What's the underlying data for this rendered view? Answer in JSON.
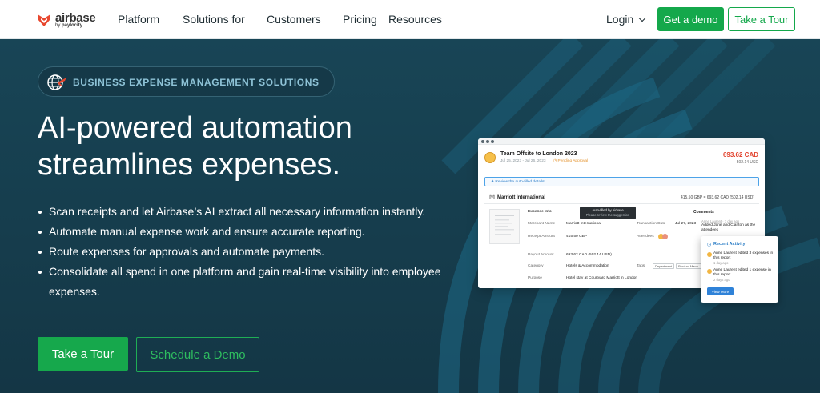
{
  "nav": {
    "logo_name": "airbase",
    "logo_sub_prefix": "by",
    "logo_sub_brand": "paylocity",
    "links": [
      "Platform",
      "Solutions for",
      "Customers",
      "Pricing",
      "Resources"
    ],
    "login": "Login",
    "get_demo": "Get a demo",
    "take_tour": "Take a Tour"
  },
  "hero": {
    "badge": "BUSINESS EXPENSE MANAGEMENT SOLUTIONS",
    "headline_line1": "AI-powered automation",
    "headline_line2": "streamlines expenses.",
    "bullets": [
      "Scan receipts and let Airbase’s AI extract all necessary information instantly.",
      "Automate manual expense work and ensure accurate reporting.",
      "Route expenses for approvals and automate payments.",
      "Consolidate all spend in one platform and gain real-time visibility into employee expenses."
    ],
    "cta_tour": "Take a Tour",
    "cta_demo": "Schedule a Demo"
  },
  "app": {
    "trip_title": "Team Offsite to London 2023",
    "trip_dates": "Jul 25, 2023 - Jul 26, 2023",
    "trip_status": "Pending Approval",
    "trip_amount": "693.62 CAD",
    "trip_amount_usd": "502.14 USD",
    "review_text": "Review the auto-filled details!",
    "merchant_title": "Marriott International",
    "merchant_amount": "415.50 GBP = 693.62 CAD (502.14 USD)",
    "section": "Expense Info",
    "fields": {
      "merchant_label": "Merchant Name",
      "merchant_value": "Marriott International",
      "receipt_label": "Receipt Amount",
      "receipt_value": "415.50 GBP",
      "payout_label": "Payout Amount",
      "payout_value": "693.62 CAD (502.14 USD)",
      "category_label": "Category",
      "category_value": "Hotels & Accommodation",
      "purpose_label": "Purpose",
      "purpose_value": "Hotel stay at Courtyard Marriott in London",
      "txn_label": "Transaction Date",
      "txn_value": "Jul 27, 2023",
      "attendees_label": "Attendees",
      "tags_label": "Tags",
      "tag1": "Department",
      "tag2": "Product Mana..."
    },
    "tooltip_line1": "Auto-filled by Airbase",
    "tooltip_line2": "Please review the suggestion",
    "comments_label": "Comments",
    "comment_author": "Anne Laurent · 1 day ago",
    "comment_text": "Added Jane and Clanton as the attendees",
    "activity_title": "Recent Activity",
    "activity": [
      {
        "text": "Anne Laurent edited 3 expenses in this report",
        "time": "1 day ago"
      },
      {
        "text": "Anne Laurent edited 1 expense in this report",
        "time": "2 days ago"
      }
    ],
    "view_more": "View More"
  },
  "colors": {
    "brand_green": "#14a84b",
    "hero_bg": "#173d4f",
    "accent_red": "#e2442f"
  }
}
